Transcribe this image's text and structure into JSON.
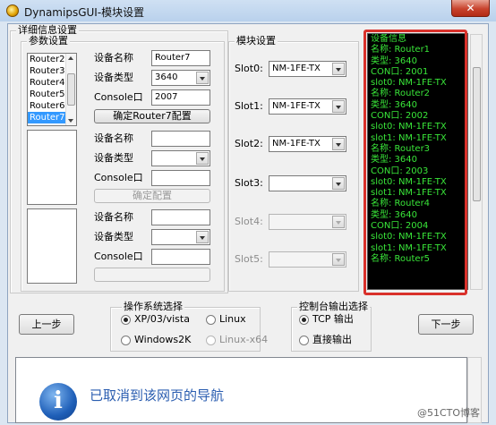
{
  "window": {
    "title": "DynamipsGUI-模块设置",
    "close_label": "✕"
  },
  "detail_group": {
    "label": "详细信息设置"
  },
  "param_group": {
    "label": "参数设置"
  },
  "router_list": {
    "items": [
      "Router2",
      "Router3",
      "Router4",
      "Router5",
      "Router6",
      "Router7"
    ],
    "selected": "Router7"
  },
  "device1": {
    "name_label": "设备名称",
    "name_value": "Router7",
    "type_label": "设备类型",
    "type_value": "3640",
    "console_label": "Console口",
    "console_value": "2007",
    "confirm_button": "确定Router7配置"
  },
  "device2": {
    "name_label": "设备名称",
    "type_label": "设备类型",
    "console_label": "Console口",
    "confirm_button": "确定配置"
  },
  "device3": {
    "name_label": "设备名称",
    "type_label": "设备类型",
    "console_label": "Console口"
  },
  "module_group": {
    "label": "模块设置"
  },
  "slots": [
    {
      "label": "Slot0:",
      "value": "NM-1FE-TX",
      "enabled": true
    },
    {
      "label": "Slot1:",
      "value": "NM-1FE-TX",
      "enabled": true
    },
    {
      "label": "Slot2:",
      "value": "NM-1FE-TX",
      "enabled": true
    },
    {
      "label": "Slot3:",
      "value": "",
      "enabled": true
    },
    {
      "label": "Slot4:",
      "value": "",
      "enabled": false
    },
    {
      "label": "Slot5:",
      "value": "",
      "enabled": false
    }
  ],
  "device_info_lines": [
    "设备信息",
    "名称: Router1",
    "类型: 3640",
    "CON口: 2001",
    "slot0: NM-1FE-TX",
    "名称: Router2",
    "类型: 3640",
    "CON口: 2002",
    "slot0: NM-1FE-TX",
    "slot1: NM-1FE-TX",
    "名称: Router3",
    "类型: 3640",
    "CON口: 2003",
    "slot0: NM-1FE-TX",
    "slot1: NM-1FE-TX",
    "名称: Router4",
    "类型: 3640",
    "CON口: 2004",
    "slot0: NM-1FE-TX",
    "slot1: NM-1FE-TX",
    "名称: Router5"
  ],
  "os_group": {
    "label": "操作系统选择",
    "options": [
      {
        "label": "XP/03/vista",
        "selected": true,
        "enabled": true
      },
      {
        "label": "Linux",
        "selected": false,
        "enabled": true
      },
      {
        "label": "Windows2K",
        "selected": false,
        "enabled": true
      },
      {
        "label": "Linux-x64",
        "selected": false,
        "enabled": false
      }
    ]
  },
  "console_group": {
    "label": "控制台输出选择",
    "options": [
      {
        "label": "TCP 输出",
        "selected": true
      },
      {
        "label": "直接输出",
        "selected": false
      }
    ]
  },
  "nav": {
    "prev": "上一步",
    "next": "下一步"
  },
  "message": {
    "text": "已取消到该网页的导航",
    "icon": "info-icon"
  },
  "watermark": "@51CTO博客",
  "colors": {
    "info_text": "#39e639",
    "highlight": "#d9312b",
    "selection": "#3399ff"
  }
}
